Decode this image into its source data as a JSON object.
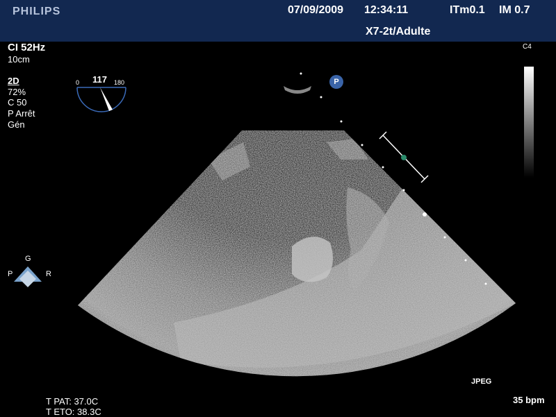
{
  "header": {
    "brand": "PHILIPS",
    "date": "07/09/2009",
    "time": "12:34:11",
    "itm": "ITm0.1",
    "im": "IM 0.7",
    "probe": "X7-2t/Adulte"
  },
  "left_panel": {
    "ci": "CI 52Hz",
    "depth": "10cm",
    "mode": "2D",
    "gain": " 72%",
    "compression": "C 50",
    "power": "P Arrêt",
    "gen": "Gén"
  },
  "angle_indicator": {
    "min": "0",
    "value": "117",
    "max": "180"
  },
  "orientation": {
    "top": "G",
    "left": "P",
    "right": "R"
  },
  "right_panel": {
    "c4": "C4"
  },
  "footer": {
    "jpeg": "JPEG",
    "bpm": "35 bpm",
    "t_pat": "T PAT: 37.0C",
    "t_eto": "T ETO: 38.3C"
  },
  "colors": {
    "header_bg": "#122850",
    "marker_green": "#2a8a6a",
    "marker_blue": "#3a64a8"
  },
  "icons": {
    "p_marker": "P"
  }
}
